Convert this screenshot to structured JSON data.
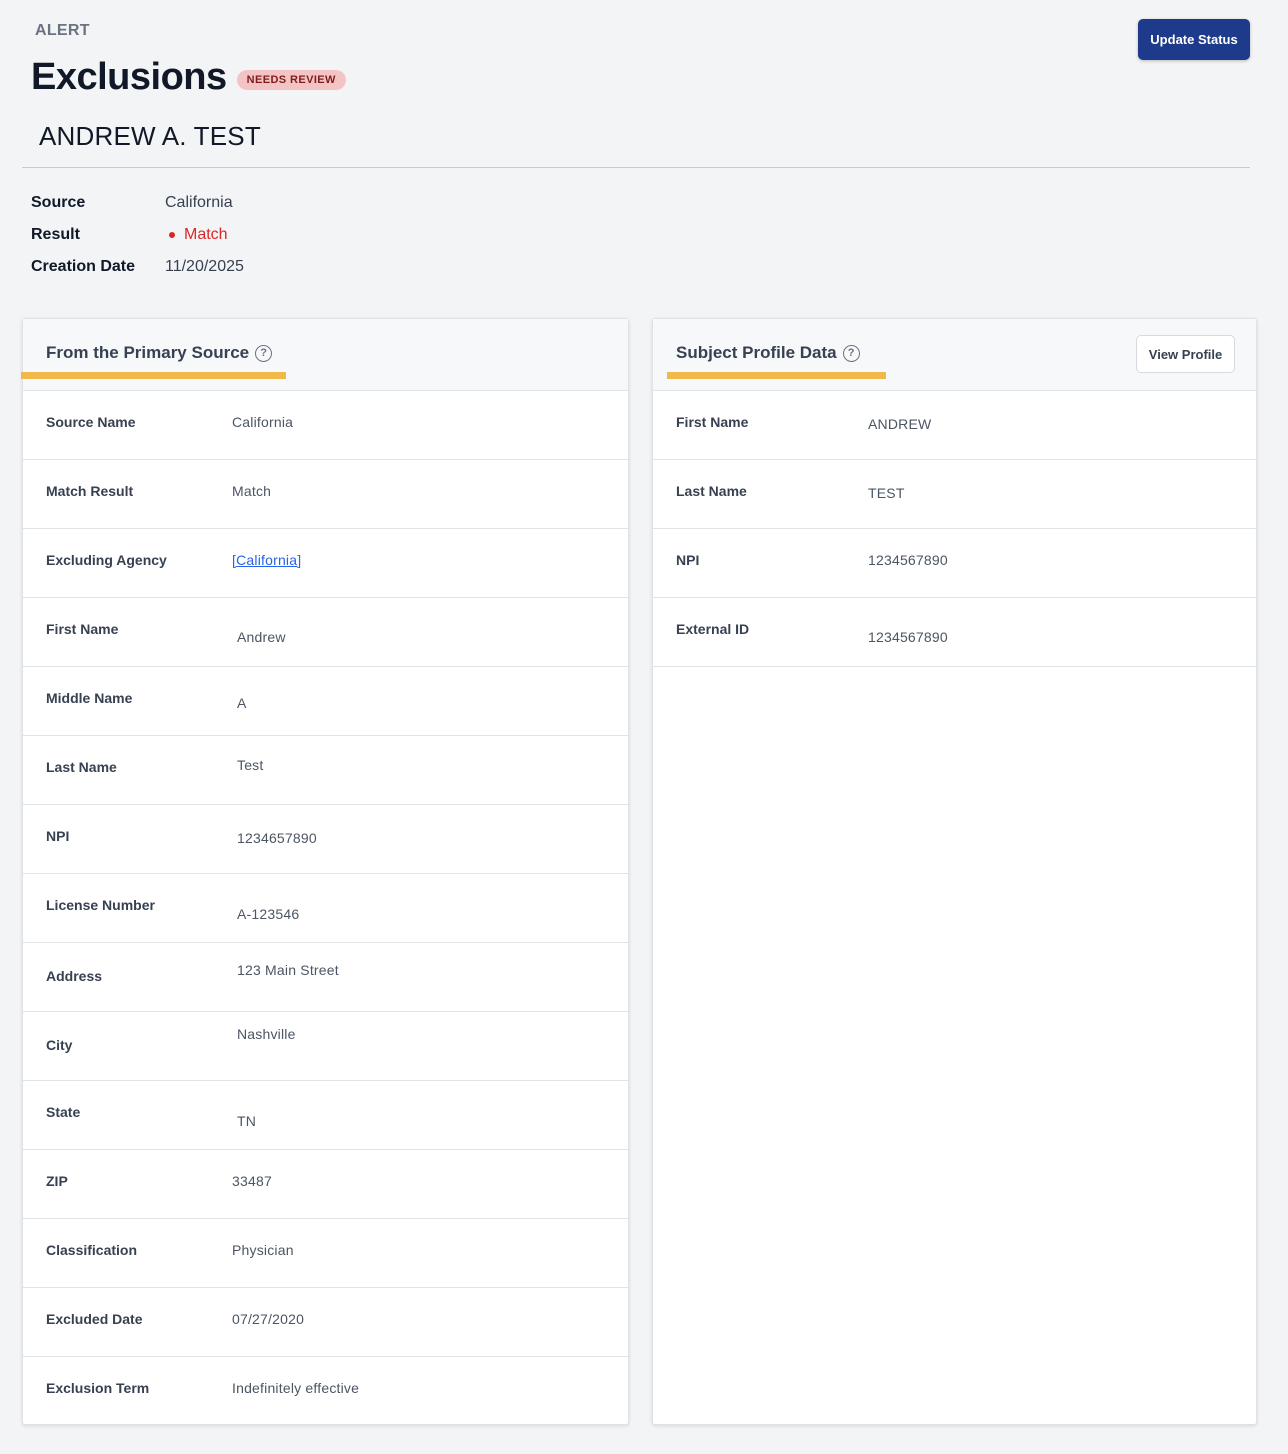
{
  "header": {
    "overline": "ALERT",
    "title": "Exclusions",
    "badge": "NEEDS REVIEW",
    "update_button": "Update Status",
    "subject_name": "ANDREW A. TEST"
  },
  "meta": {
    "source_label": "Source",
    "source_value": "California",
    "result_label": "Result",
    "result_value": "Match",
    "creation_label": "Creation Date",
    "creation_value": "11/20/2025"
  },
  "primary_source": {
    "title": "From the Primary Source",
    "rows": [
      {
        "label": "Source Name",
        "value": "California"
      },
      {
        "label": "Match Result",
        "value": "Match"
      },
      {
        "label": "Excluding Agency",
        "value": "[California]"
      },
      {
        "label": "First Name",
        "value": "Andrew"
      },
      {
        "label": "Middle Name",
        "value": "A"
      },
      {
        "label": "Last Name",
        "value": "Test"
      },
      {
        "label": "NPI",
        "value": "1234657890"
      },
      {
        "label": "License Number",
        "value": "A-123546"
      },
      {
        "label": "Address",
        "value": "123 Main Street"
      },
      {
        "label": "City",
        "value": "Nashville"
      },
      {
        "label": "State",
        "value": "TN"
      },
      {
        "label": "ZIP",
        "value": "33487"
      },
      {
        "label": "Classification",
        "value": "Physician"
      },
      {
        "label": "Excluded Date",
        "value": "07/27/2020"
      },
      {
        "label": "Exclusion Term",
        "value": "Indefinitely effective"
      }
    ]
  },
  "subject_profile": {
    "title": "Subject Profile Data",
    "view_button": "View Profile",
    "rows": [
      {
        "label": "First Name",
        "value": "ANDREW"
      },
      {
        "label": "Last Name",
        "value": "TEST"
      },
      {
        "label": "NPI",
        "value": "1234567890"
      },
      {
        "label": "External ID",
        "value": "1234567890"
      }
    ]
  },
  "icons": {
    "help": "help-circle-icon",
    "result_dot": "status-dot-icon"
  },
  "colors": {
    "primary_button": "#1e3a8a",
    "badge_bg": "#f4c4c4",
    "match_red": "#dc2626",
    "tab_underline": "#f0b94a",
    "link": "#2563eb"
  }
}
